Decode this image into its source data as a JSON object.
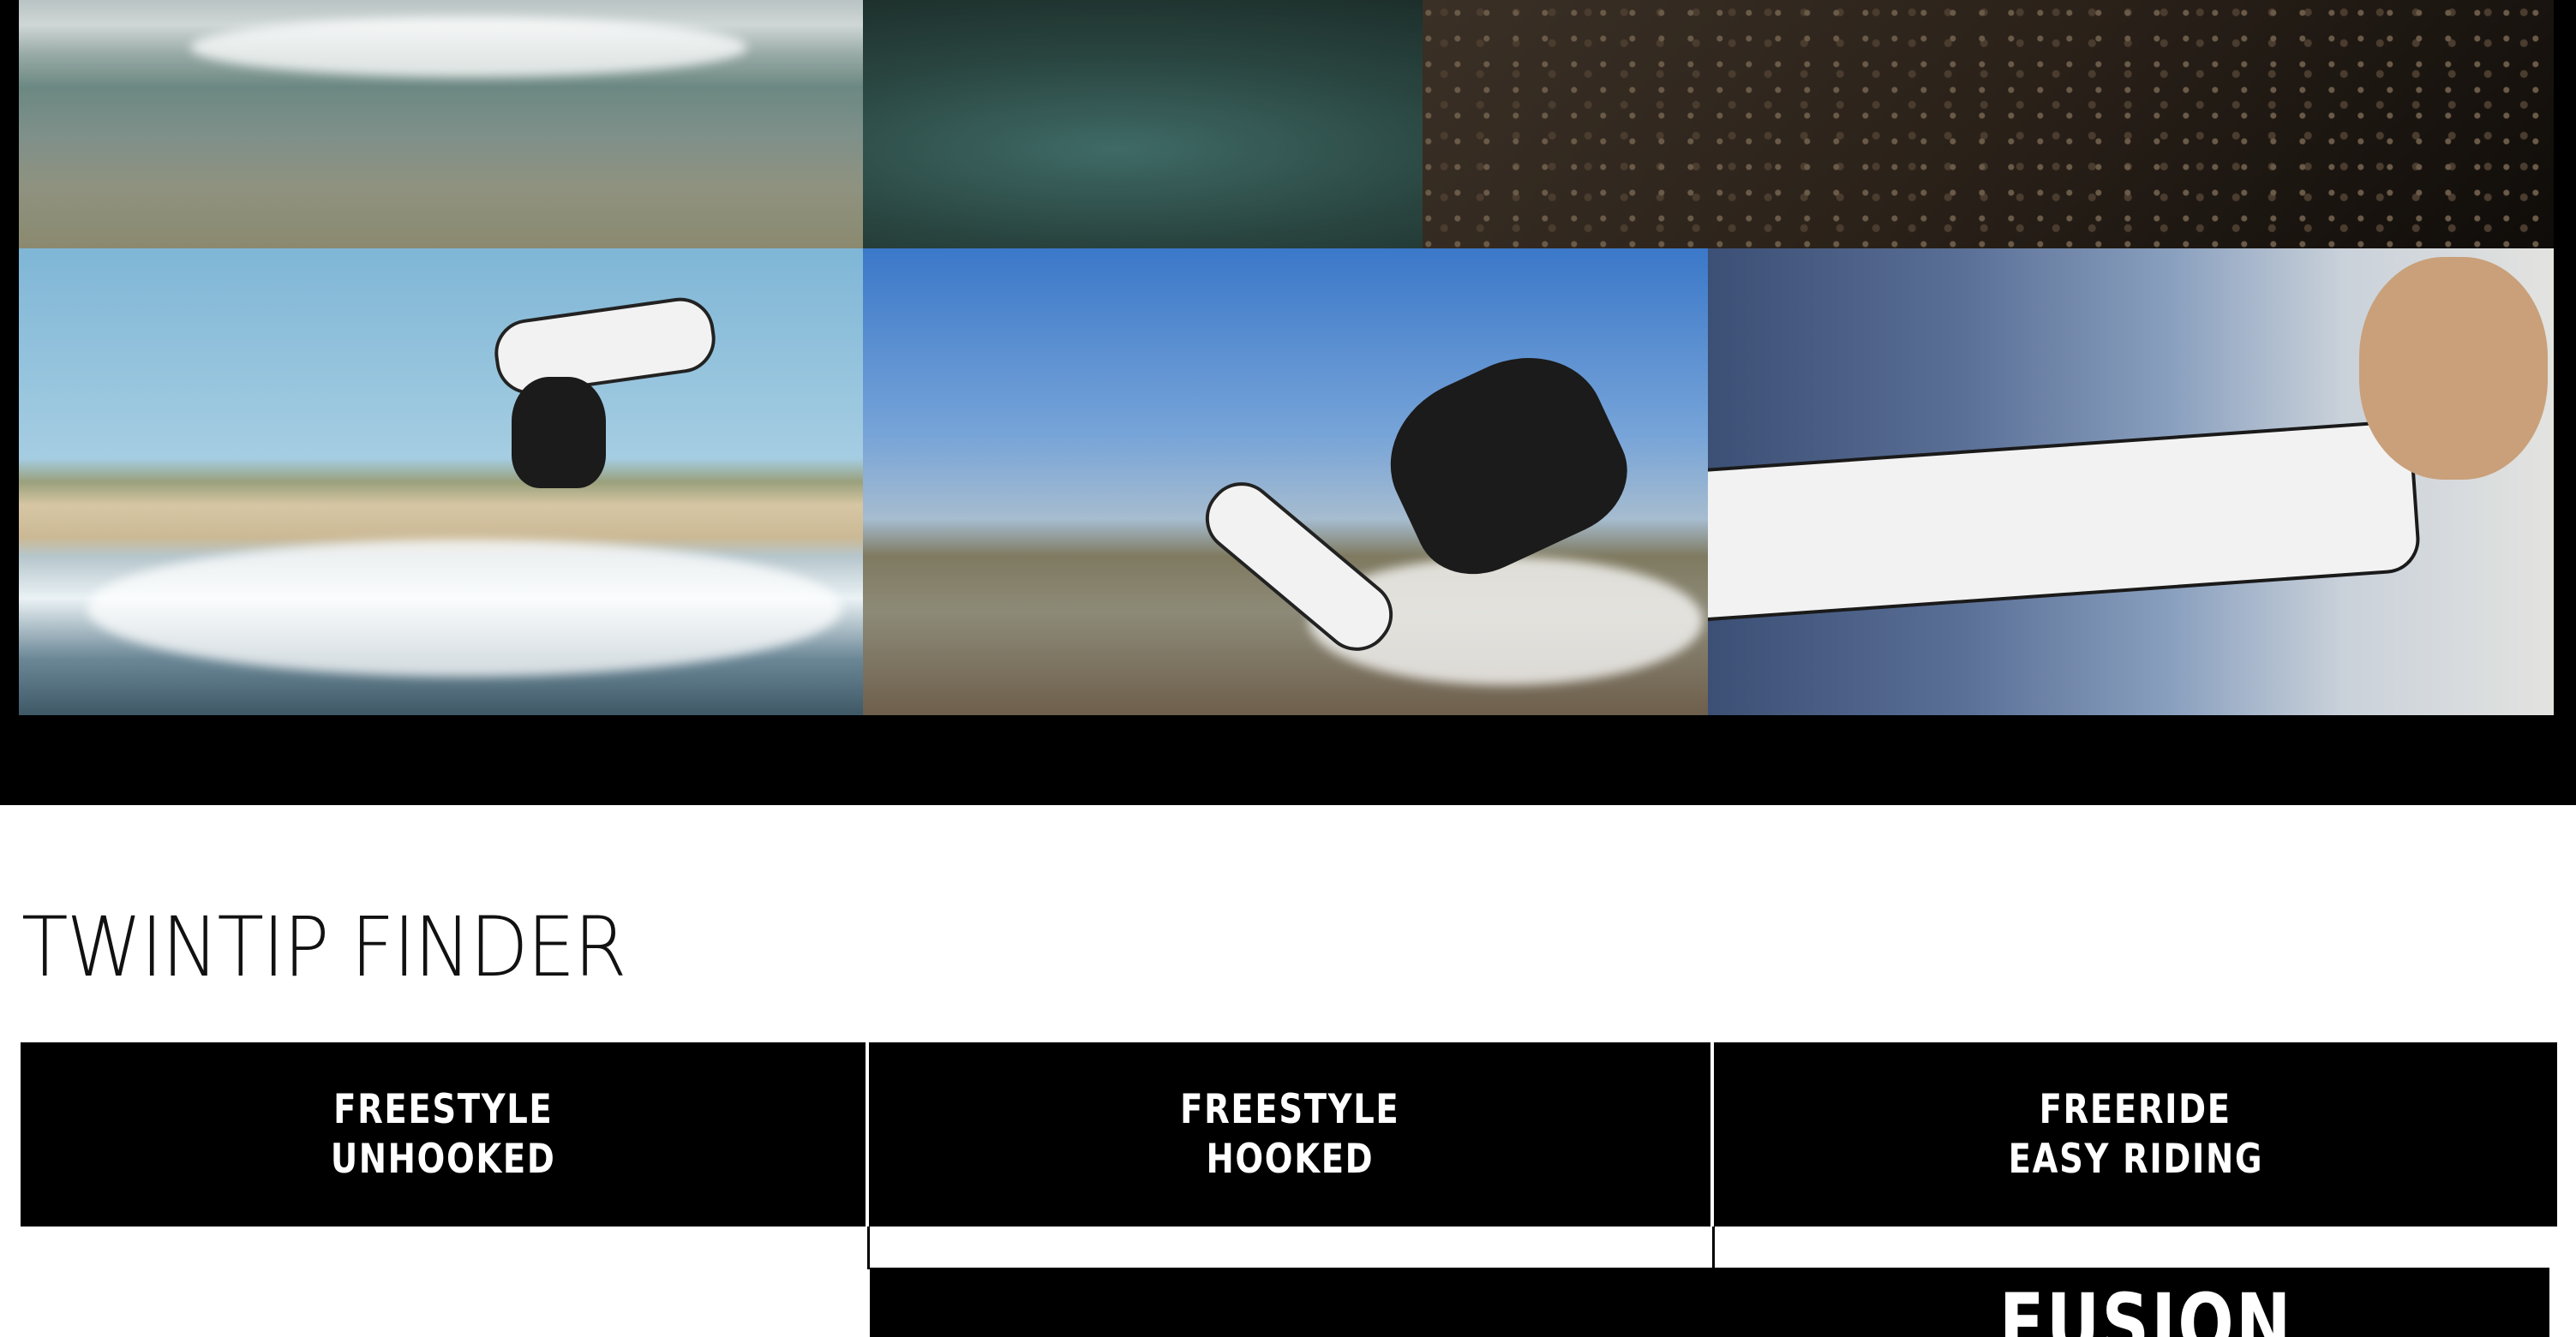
{
  "gallery": {
    "photos": [
      {
        "subject": "kiteboarder spray on water"
      },
      {
        "subject": "water surface close-up"
      },
      {
        "subject": "textured traction pad close-up"
      },
      {
        "subject": "kiteboarder jumping with board over waves"
      },
      {
        "subject": "kiteboarder riding near shore"
      },
      {
        "subject": "rider holding board portrait"
      }
    ]
  },
  "finder": {
    "title": "TWINTIP FINDER",
    "columns": [
      {
        "line1": "FREESTYLE",
        "line2": "UNHOOKED"
      },
      {
        "line1": "FREESTYLE",
        "line2": "HOOKED"
      },
      {
        "line1": "FREERIDE",
        "line2": "EASY RIDING"
      }
    ],
    "product": "FUSION"
  }
}
